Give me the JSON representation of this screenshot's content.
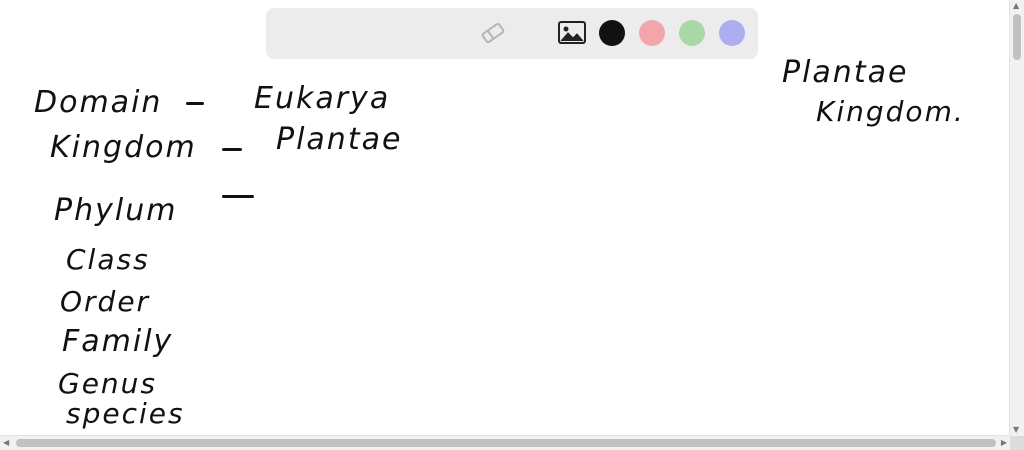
{
  "toolbar": {
    "tools": [
      {
        "icon": "eraser-icon"
      },
      {
        "icon": "image-icon"
      }
    ],
    "swatches": [
      {
        "name": "color-swatch-black",
        "color": "#111111"
      },
      {
        "name": "color-swatch-red",
        "color": "#f2a6ac"
      },
      {
        "name": "color-swatch-green",
        "color": "#a9d8a7"
      },
      {
        "name": "color-swatch-blue",
        "color": "#acaef0"
      }
    ]
  },
  "notes": {
    "domain_label": "Domain",
    "domain_value": "Eukarya",
    "kingdom_label": "Kingdom",
    "kingdom_value": "Plantae",
    "phylum_label": "Phylum",
    "class_label": "Class",
    "order_label": "Order",
    "family_label": "Family",
    "genus_label": "Genus",
    "species_label": "species",
    "side_line1": "Plantae",
    "side_line2": "Kingdom."
  }
}
